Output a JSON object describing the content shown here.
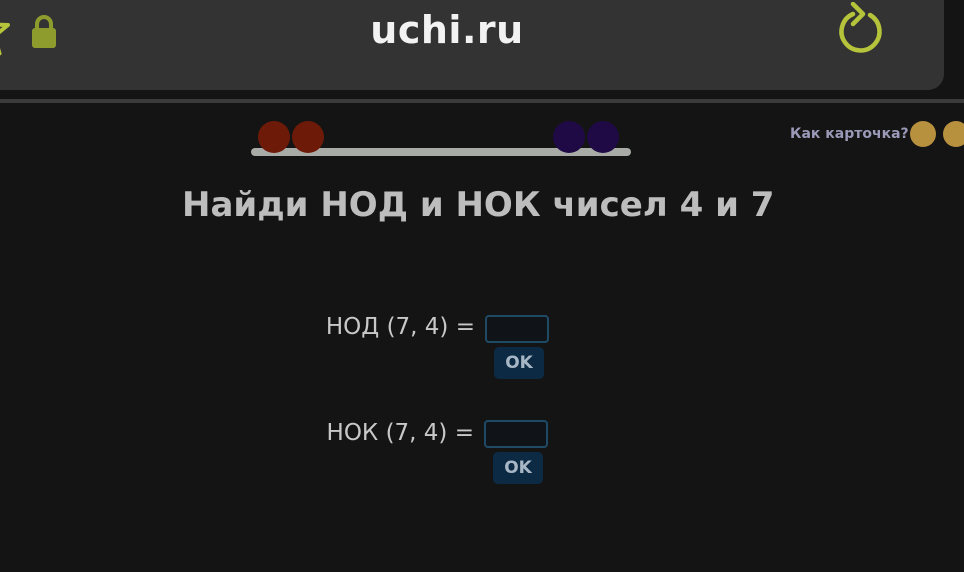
{
  "browser": {
    "url": "uchi.ru",
    "icons": {
      "bookmark": "star-icon",
      "security": "lock-icon",
      "reload": "reload-icon"
    },
    "accent_color": "#b5c43a"
  },
  "progress": {
    "completed": 2,
    "total": 4,
    "colors": [
      "#6e1a08",
      "#6e1a08",
      "#1f0a45",
      "#1f0a45"
    ]
  },
  "rating": {
    "question": "Как карточка?",
    "color": "#b8913f"
  },
  "task": {
    "title": "Найди НОД и НОК чисел 4 и 7",
    "gcd": {
      "label": "НОД (7, 4) =",
      "value": "",
      "button": "OK"
    },
    "lcm": {
      "label": "НОК (7, 4) =",
      "value": "",
      "button": "OK"
    }
  }
}
